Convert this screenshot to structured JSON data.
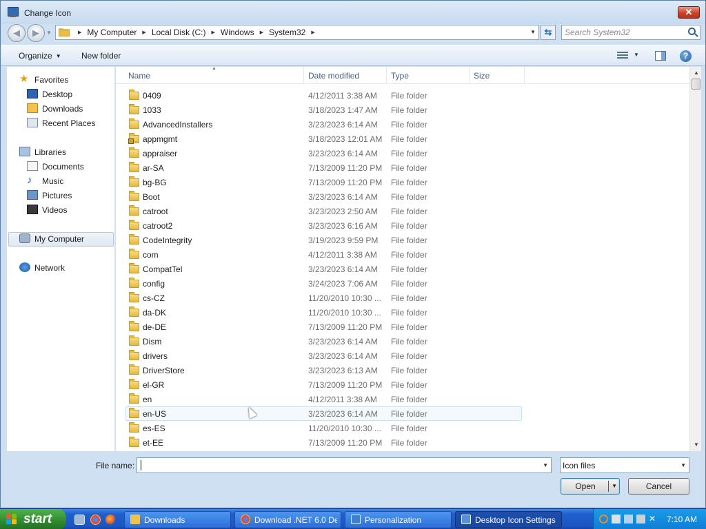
{
  "window": {
    "title": "Change Icon",
    "close_glyph": "✕"
  },
  "nav": {
    "back_glyph": "◀",
    "forward_glyph": "▶",
    "breadcrumbs": [
      "My Computer",
      "Local Disk (C:)",
      "Windows",
      "System32"
    ],
    "refresh_glyph": "⇆",
    "search_placeholder": "Search System32"
  },
  "toolbar": {
    "organize_label": "Organize",
    "new_folder_label": "New folder",
    "help_glyph": "?"
  },
  "sidebar": {
    "favorites_label": "Favorites",
    "favorites": [
      {
        "label": "Desktop",
        "icon": "desktop-icon"
      },
      {
        "label": "Downloads",
        "icon": "downloads-folder-icon"
      },
      {
        "label": "Recent Places",
        "icon": "recent-places-icon"
      }
    ],
    "libraries_label": "Libraries",
    "libraries": [
      {
        "label": "Documents",
        "icon": "documents-icon"
      },
      {
        "label": "Music",
        "icon": "music-icon"
      },
      {
        "label": "Pictures",
        "icon": "pictures-icon"
      },
      {
        "label": "Videos",
        "icon": "videos-icon"
      }
    ],
    "computer_label": "My Computer",
    "network_label": "Network",
    "selected": "My Computer"
  },
  "columns": {
    "name": "Name",
    "date": "Date modified",
    "type": "Type",
    "size": "Size"
  },
  "files": [
    {
      "name": "0409",
      "date": "4/12/2011 3:38 AM",
      "type": "File folder"
    },
    {
      "name": "1033",
      "date": "3/18/2023 1:47 AM",
      "type": "File folder"
    },
    {
      "name": "AdvancedInstallers",
      "date": "3/23/2023 6:14 AM",
      "type": "File folder"
    },
    {
      "name": "appmgmt",
      "date": "3/18/2023 12:01 AM",
      "type": "File folder",
      "locked": true
    },
    {
      "name": "appraiser",
      "date": "3/23/2023 6:14 AM",
      "type": "File folder"
    },
    {
      "name": "ar-SA",
      "date": "7/13/2009 11:20 PM",
      "type": "File folder"
    },
    {
      "name": "bg-BG",
      "date": "7/13/2009 11:20 PM",
      "type": "File folder"
    },
    {
      "name": "Boot",
      "date": "3/23/2023 6:14 AM",
      "type": "File folder"
    },
    {
      "name": "catroot",
      "date": "3/23/2023 2:50 AM",
      "type": "File folder"
    },
    {
      "name": "catroot2",
      "date": "3/23/2023 6:16 AM",
      "type": "File folder"
    },
    {
      "name": "CodeIntegrity",
      "date": "3/19/2023 9:59 PM",
      "type": "File folder"
    },
    {
      "name": "com",
      "date": "4/12/2011 3:38 AM",
      "type": "File folder"
    },
    {
      "name": "CompatTel",
      "date": "3/23/2023 6:14 AM",
      "type": "File folder"
    },
    {
      "name": "config",
      "date": "3/24/2023 7:06 AM",
      "type": "File folder"
    },
    {
      "name": "cs-CZ",
      "date": "11/20/2010 10:30 ...",
      "type": "File folder"
    },
    {
      "name": "da-DK",
      "date": "11/20/2010 10:30 ...",
      "type": "File folder"
    },
    {
      "name": "de-DE",
      "date": "7/13/2009 11:20 PM",
      "type": "File folder"
    },
    {
      "name": "Dism",
      "date": "3/23/2023 6:14 AM",
      "type": "File folder"
    },
    {
      "name": "drivers",
      "date": "3/23/2023 6:14 AM",
      "type": "File folder"
    },
    {
      "name": "DriverStore",
      "date": "3/23/2023 6:13 AM",
      "type": "File folder"
    },
    {
      "name": "el-GR",
      "date": "7/13/2009 11:20 PM",
      "type": "File folder"
    },
    {
      "name": "en",
      "date": "4/12/2011 3:38 AM",
      "type": "File folder"
    },
    {
      "name": "en-US",
      "date": "3/23/2023 6:14 AM",
      "type": "File folder",
      "hovered": true
    },
    {
      "name": "es-ES",
      "date": "11/20/2010 10:30 ...",
      "type": "File folder"
    },
    {
      "name": "et-EE",
      "date": "7/13/2009 11:20 PM",
      "type": "File folder"
    }
  ],
  "bottom": {
    "file_name_label": "File name:",
    "file_name_value": "",
    "file_type_value": "Icon files",
    "open_label": "Open",
    "cancel_label": "Cancel"
  },
  "taskbar": {
    "start_label": "start",
    "tasks": [
      {
        "label": "Downloads",
        "icon": "folder-icon",
        "active": false
      },
      {
        "label": "Download .NET 6.0 De...",
        "icon": "chrome-icon",
        "active": false
      },
      {
        "label": "Personalization",
        "icon": "control-panel-icon",
        "active": false
      },
      {
        "label": "Desktop Icon Settings",
        "icon": "settings-icon",
        "active": true
      }
    ],
    "clock": "7:10 AM"
  },
  "colors": {
    "accent": "#3a6ea5",
    "taskbar": "#1f5fcf",
    "start": "#2f8a2e",
    "close": "#c9442a"
  }
}
